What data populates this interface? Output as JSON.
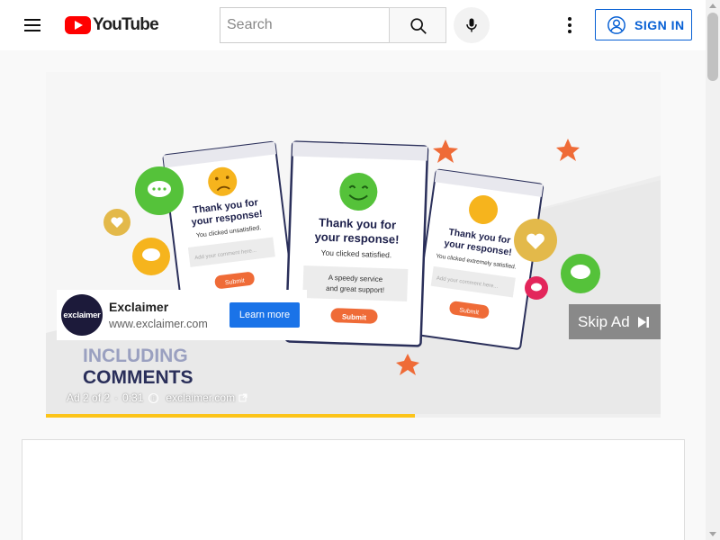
{
  "header": {
    "logo_text": "YouTube",
    "search_placeholder": "Search",
    "search_value": "",
    "sign_in_label": "SIGN IN",
    "icons": [
      "menu-icon",
      "youtube-logo-icon",
      "search-icon",
      "mic-icon",
      "more-vert-icon",
      "account-icon"
    ],
    "accent_color": "#065fd4",
    "brand_color": "#ff0000"
  },
  "ad_creative": {
    "headline_line1": "INCLUDING",
    "headline_line2": "COMMENTS",
    "cards": [
      {
        "title_line1": "Thank you for",
        "title_line2": "your response!",
        "subtitle": "You clicked unsatisfied.",
        "placeholder": "Add your comment here...",
        "submit": "Submit",
        "mood": "unsatisfied"
      },
      {
        "title_line1": "Thank you for",
        "title_line2": "your response!",
        "subtitle": "You clicked satisfied.",
        "comment_line1": "A speedy service",
        "comment_line2": "and great support!",
        "submit": "Submit",
        "mood": "satisfied"
      },
      {
        "title_line1": "Thank you for",
        "title_line2": "your response!",
        "subtitle": "You clicked extremely satisfied.",
        "placeholder": "Add your comment here...",
        "submit": "Submit",
        "mood": "extremely satisfied"
      }
    ]
  },
  "advertiser": {
    "logo_text": "exclaimer",
    "name": "Exclaimer",
    "url": "www.exclaimer.com",
    "cta_label": "Learn more"
  },
  "player": {
    "skip_label": "Skip Ad",
    "ad_position": "Ad 2 of 2",
    "separator": "·",
    "time_remaining": "0:31",
    "info_glyph": "i",
    "domain": "exclaimer.com",
    "progress_fraction": 0.6
  }
}
